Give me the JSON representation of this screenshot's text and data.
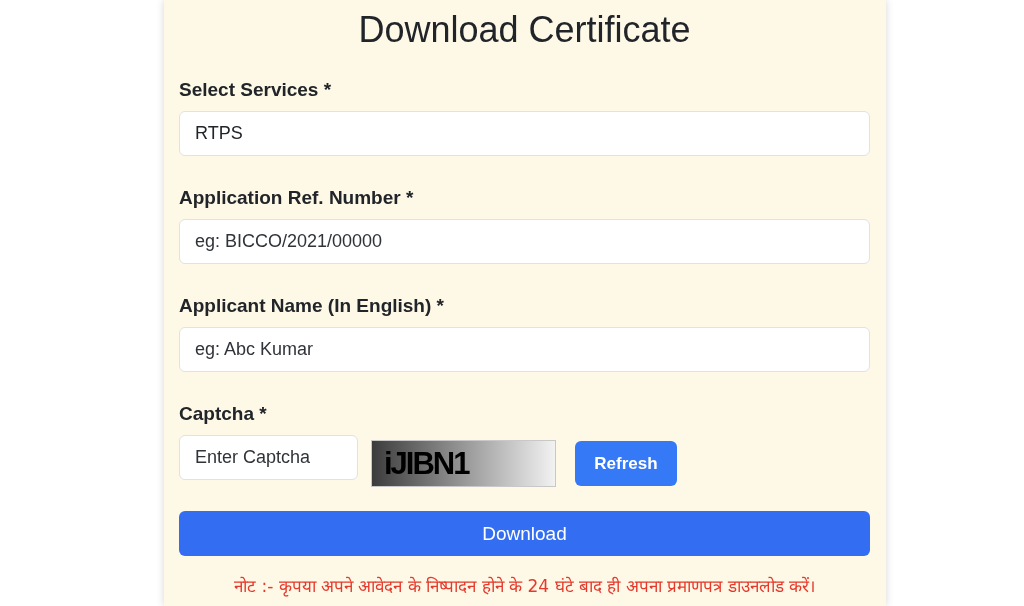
{
  "title": "Download Certificate",
  "fields": [
    {
      "label": "Select Services *",
      "value": "RTPS"
    },
    {
      "label": "Application Ref. Number *",
      "placeholder": "eg: BICCO/2021/00000"
    },
    {
      "label": "Applicant Name (In English) *",
      "placeholder": "eg: Abc Kumar"
    }
  ],
  "captcha": {
    "label": "Captcha *",
    "placeholder": "Enter Captcha",
    "code": "iJIBN1",
    "refresh_button": "Refresh"
  },
  "download_button": "Download",
  "note": "नोट :- कृपया अपने आवेदन के निष्पादन होने के 24 घंटे बाद ही अपना प्रमाणपत्र डाउनलोड करें।"
}
